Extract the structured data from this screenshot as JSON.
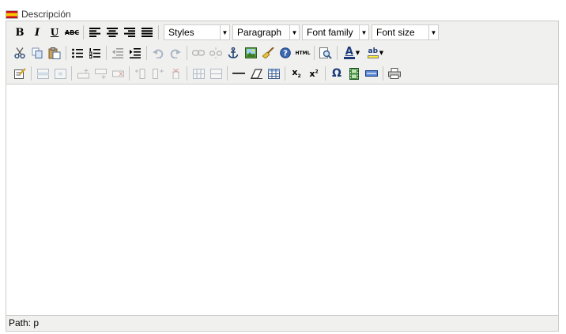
{
  "field": {
    "label": "Descripción",
    "flag_icon": "spain-flag-icon"
  },
  "toolbar": {
    "bold": "B",
    "italic": "I",
    "underline": "U",
    "strikethrough": "ABC",
    "styles_value": "Styles",
    "format_value": "Paragraph",
    "font_family_value": "Font family",
    "font_size_value": "Font size",
    "html_label": "HTML",
    "sub_label": "x",
    "sup_label": "x",
    "omega": "Ω",
    "font_color_letter": "A",
    "highlight_letters": "ab"
  },
  "status": {
    "path": "Path: p"
  }
}
